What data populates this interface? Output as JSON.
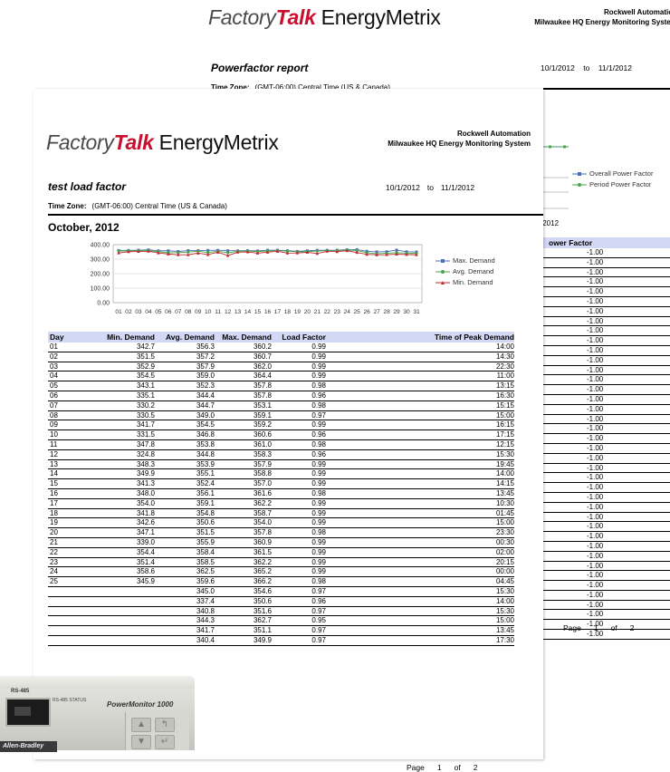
{
  "background_report": {
    "logo": {
      "factory": "Factory",
      "talk": "Talk",
      "energymetrix": " EnergyMetrix"
    },
    "company_line1": "Rockwell Automation",
    "company_line2": "Milwaukee HQ Energy Monitoring System",
    "title": "Powerfactor report",
    "date_range": "10/1/2012    to    11/1/2012",
    "timezone_label": "Time Zone:",
    "timezone_value": "(GMT-06:00) Central Time (US & Canada)",
    "chart_date_fragment": "/2012",
    "legend": [
      "Overall Power Factor",
      "Period Power Factor"
    ],
    "column_header": "ower Factor",
    "values": [
      "-1.00",
      "-1.00",
      "-1.00",
      "-1.00",
      "-1.00",
      "-1.00",
      "-1.00",
      "-1.00",
      "-1.00",
      "-1.00",
      "-1.00",
      "-1.00",
      "-1.00",
      "-1.00",
      "-1.00",
      "-1.00",
      "-1.00",
      "-1.00",
      "-1.00",
      "-1.00",
      "-1.00",
      "-1.00",
      "-1.00",
      "-1.00",
      "-1.00",
      "-1.00",
      "-1.00",
      "-1.00",
      "-1.00",
      "-1.00",
      "-1.00",
      "-1.00",
      "-1.00",
      "-1.00",
      "-1.00",
      "-1.00",
      "-1.00",
      "-1.00",
      "-1.00",
      "-1.00"
    ],
    "footer": {
      "page_label": "Page",
      "page_num": "1",
      "of": "of",
      "total": "2"
    }
  },
  "report": {
    "logo": {
      "factory": "Factory",
      "talk": "Talk",
      "energymetrix": " EnergyMetrix"
    },
    "company_line1": "Rockwell Automation",
    "company_line2": "Milwaukee HQ Energy Monitoring System",
    "title": "test load factor",
    "date_from": "10/1/2012",
    "date_to_label": "to",
    "date_to": "11/1/2012",
    "timezone_label": "Time Zone:",
    "timezone_value": "(GMT-06:00) Central Time (US & Canada)",
    "month": "October, 2012",
    "table_headers": {
      "day": "Day",
      "min": "Min. Demand",
      "avg": "Avg. Demand",
      "max": "Max. Demand",
      "lf": "Load Factor",
      "time": "Time of Peak Demand"
    },
    "rows": [
      [
        "01",
        "342.7",
        "356.3",
        "360.2",
        "0.99",
        "14:00"
      ],
      [
        "02",
        "351.5",
        "357.2",
        "360.7",
        "0.99",
        "14:30"
      ],
      [
        "03",
        "352.9",
        "357.9",
        "362.0",
        "0.99",
        "22:30"
      ],
      [
        "04",
        "354.5",
        "359.0",
        "364.4",
        "0.99",
        "11:00"
      ],
      [
        "05",
        "343.1",
        "352.3",
        "357.8",
        "0.98",
        "13:15"
      ],
      [
        "06",
        "335.1",
        "344.4",
        "357.8",
        "0.96",
        "16:30"
      ],
      [
        "07",
        "330.2",
        "344.7",
        "353.1",
        "0.98",
        "15:15"
      ],
      [
        "08",
        "330.5",
        "349.0",
        "359.1",
        "0.97",
        "15:00"
      ],
      [
        "09",
        "341.7",
        "354.5",
        "359.2",
        "0.99",
        "16:15"
      ],
      [
        "10",
        "331.5",
        "346.8",
        "360.6",
        "0.96",
        "17:15"
      ],
      [
        "11",
        "347.8",
        "353.8",
        "361.0",
        "0.98",
        "12:15"
      ],
      [
        "12",
        "324.8",
        "344.8",
        "358.3",
        "0.96",
        "15:30"
      ],
      [
        "13",
        "348.3",
        "353.9",
        "357.9",
        "0.99",
        "19:45"
      ],
      [
        "14",
        "349.9",
        "355.1",
        "358.8",
        "0.99",
        "14:00"
      ],
      [
        "15",
        "341.3",
        "352.4",
        "357.0",
        "0.99",
        "14:15"
      ],
      [
        "16",
        "348.0",
        "356.1",
        "361.6",
        "0.98",
        "13:45"
      ],
      [
        "17",
        "354.0",
        "359.1",
        "362.2",
        "0.99",
        "10:30"
      ],
      [
        "18",
        "341.8",
        "354.8",
        "358.7",
        "0.99",
        "01:45"
      ],
      [
        "19",
        "342.6",
        "350.6",
        "354.0",
        "0.99",
        "15:00"
      ],
      [
        "20",
        "347.1",
        "351.5",
        "357.8",
        "0.98",
        "23:30"
      ],
      [
        "21",
        "339.0",
        "355.9",
        "360.9",
        "0.99",
        "00:30"
      ],
      [
        "22",
        "354.4",
        "358.4",
        "361.5",
        "0.99",
        "02:00"
      ],
      [
        "23",
        "351.4",
        "358.5",
        "362.2",
        "0.99",
        "20:15"
      ],
      [
        "24",
        "358.6",
        "362.5",
        "365.2",
        "0.99",
        "00:00"
      ],
      [
        "25",
        "345.9",
        "359.6",
        "366.2",
        "0.98",
        "04:45"
      ],
      [
        "",
        "",
        "345.0",
        "354.6",
        "0.97",
        "15:30"
      ],
      [
        "",
        "",
        "337.4",
        "350.6",
        "0.96",
        "14:00"
      ],
      [
        "",
        "",
        "340.8",
        "351.6",
        "0.97",
        "15:30"
      ],
      [
        "",
        "",
        "344.3",
        "362.7",
        "0.95",
        "15:00"
      ],
      [
        "",
        "",
        "341.7",
        "351.1",
        "0.97",
        "13:45"
      ],
      [
        "",
        "",
        "340.4",
        "349.9",
        "0.97",
        "17:30"
      ]
    ],
    "footer": {
      "page_label": "Page",
      "page_num": "1",
      "of": "of",
      "total": "2"
    }
  },
  "chart_data": {
    "type": "line",
    "x": [
      "01",
      "02",
      "03",
      "04",
      "05",
      "06",
      "07",
      "08",
      "09",
      "10",
      "11",
      "12",
      "13",
      "14",
      "15",
      "16",
      "17",
      "18",
      "19",
      "20",
      "21",
      "22",
      "23",
      "24",
      "25",
      "26",
      "27",
      "28",
      "29",
      "30",
      "31"
    ],
    "series": [
      {
        "name": "Max. Demand",
        "color": "#4f6fb5",
        "values": [
          360.2,
          360.7,
          362.0,
          364.4,
          357.8,
          357.8,
          353.1,
          359.1,
          359.2,
          360.6,
          361.0,
          358.3,
          357.9,
          358.8,
          357.0,
          361.6,
          362.2,
          358.7,
          354.0,
          357.8,
          360.9,
          361.5,
          362.2,
          365.2,
          366.2,
          354.6,
          350.6,
          351.6,
          362.7,
          351.1,
          349.9
        ]
      },
      {
        "name": "Avg. Demand",
        "color": "#4aa34a",
        "values": [
          356.3,
          357.2,
          357.9,
          359.0,
          352.3,
          344.4,
          344.7,
          349.0,
          354.5,
          346.8,
          353.8,
          344.8,
          353.9,
          355.1,
          352.4,
          356.1,
          359.1,
          354.8,
          350.6,
          351.5,
          355.9,
          358.4,
          358.5,
          362.5,
          359.6,
          345.0,
          337.4,
          340.8,
          344.3,
          341.7,
          340.4
        ]
      },
      {
        "name": "Min. Demand",
        "color": "#c0282d",
        "values": [
          342.7,
          351.5,
          352.9,
          354.5,
          343.1,
          335.1,
          330.2,
          330.5,
          341.7,
          331.5,
          347.8,
          324.8,
          348.3,
          349.9,
          341.3,
          348.0,
          354.0,
          341.8,
          342.6,
          347.1,
          339.0,
          354.4,
          351.4,
          358.6,
          345.9,
          333.0,
          330.0,
          331.0,
          334.0,
          332.0,
          330.5
        ]
      }
    ],
    "yticks": [
      "400.00",
      "300.00",
      "200.00",
      "100.00",
      "0.00"
    ],
    "ylim": [
      0,
      400
    ],
    "grid": true,
    "legend_position": "right"
  },
  "device": {
    "port_label": "RS-485",
    "led_labels": "RS-485   STATUS",
    "model": "PowerMonitor 1000",
    "brand": "Allen-Bradley"
  }
}
